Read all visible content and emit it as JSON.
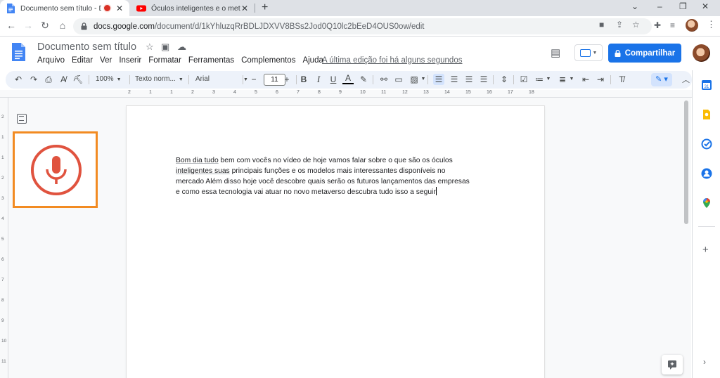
{
  "browser": {
    "tabs": [
      {
        "title": "Documento sem título - Doc",
        "active": true
      },
      {
        "title": "Óculos inteligentes e o metavers",
        "active": false
      }
    ],
    "new_tab_label": "+",
    "window_controls": {
      "minimize": "⌄",
      "min": "–",
      "restore": "❐",
      "close": "✕"
    },
    "url": {
      "host": "docs.google.com",
      "path": "/document/d/1kYhluzqRrBDLJDXVV8BSs2Jod0Q10lc2bEeD4OUS0ow/edit"
    }
  },
  "docs": {
    "title": "Documento sem título",
    "menus": [
      "Arquivo",
      "Editar",
      "Ver",
      "Inserir",
      "Formatar",
      "Ferramentas",
      "Complementos",
      "Ajuda"
    ],
    "last_edit": "A última edição foi há alguns segundos",
    "share_label": "Compartilhar",
    "toolbar": {
      "zoom": "100%",
      "style": "Texto norm...",
      "font": "Arial",
      "font_size": "11",
      "minus": "−",
      "plus": "+",
      "bold": "B",
      "italic": "I",
      "underline": "U",
      "text_color": "A"
    },
    "ruler_ticks": [
      "2",
      "1",
      "1",
      "2",
      "3",
      "4",
      "5",
      "6",
      "7",
      "8",
      "9",
      "10",
      "11",
      "12",
      "13",
      "14",
      "15",
      "16",
      "17",
      "18"
    ],
    "vruler_ticks": [
      "2",
      "1",
      "1",
      "2",
      "3",
      "4",
      "5",
      "6",
      "7",
      "8",
      "9",
      "10",
      "11"
    ],
    "body_lines": [
      {
        "pre": "",
        "sq": "Bom dia tudo",
        "post": " bem com vocês no vídeo de hoje vamos falar sobre o que são os óculos"
      },
      {
        "pre": "",
        "sq": "inteligentes suas",
        "post": " principais funções e os modelos mais interessantes disponíveis no"
      },
      {
        "pre": "mercado Além disso hoje você descobre quais serão os futuros lançamentos das empresas",
        "sq": "",
        "post": ""
      },
      {
        "pre": "e como essa tecnologia vai atuar no novo metaverso descubra tudo isso a seguir",
        "sq": "",
        "post": ""
      }
    ]
  },
  "colors": {
    "accent": "#1a73e8",
    "voice_highlight": "#f28b22",
    "mic": "#e0533f"
  }
}
